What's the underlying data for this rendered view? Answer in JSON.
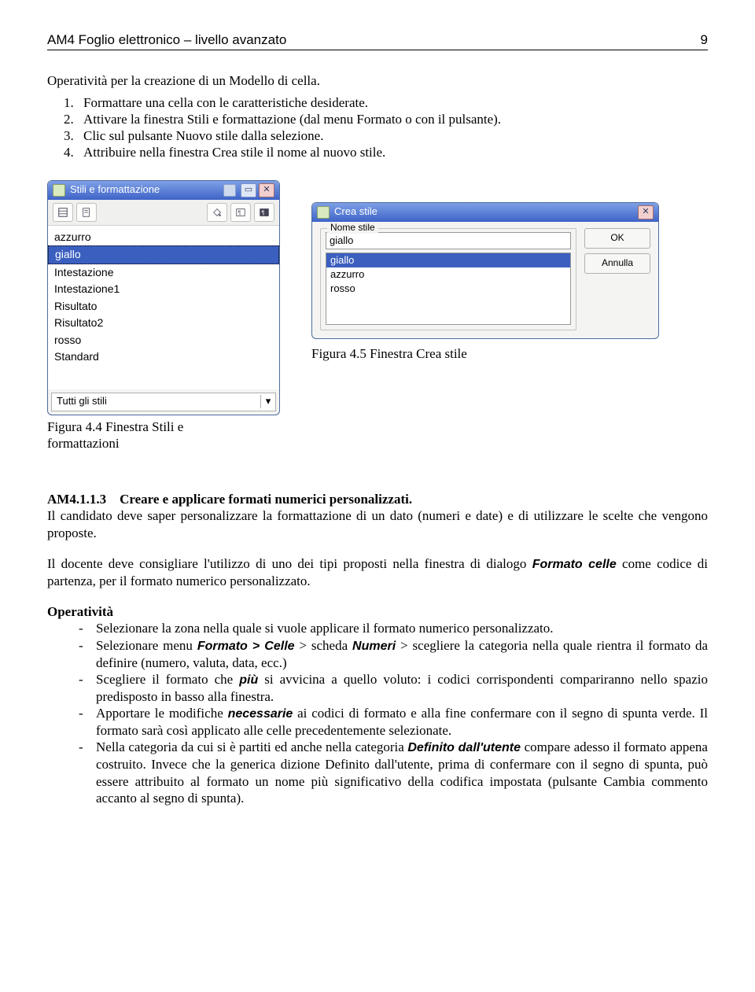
{
  "header": {
    "left": "AM4 Foglio elettronico – livello avanzato",
    "page": "9"
  },
  "section_title": "Operatività per la creazione di un Modello di cella.",
  "steps": [
    "Formattare una cella con le caratteristiche desiderate.",
    "Attivare la finestra Stili e formattazione (dal menu Formato o con il pulsante).",
    "Clic sul pulsante Nuovo stile dalla selezione.",
    "Attribuire nella finestra Crea stile il nome al nuovo stile."
  ],
  "styles_window": {
    "title": "Stili e formattazione",
    "items": [
      "azzurro",
      "giallo",
      "Intestazione",
      "Intestazione1",
      "Risultato",
      "Risultato2",
      "rosso",
      "Standard"
    ],
    "selected_index": 1,
    "combo": "Tutti gli stili"
  },
  "create_dialog": {
    "title": "Crea stile",
    "legend": "Nome stile",
    "input_value": "giallo",
    "list": [
      "giallo",
      "azzurro",
      "rosso"
    ],
    "selected_index": 0,
    "ok": "OK",
    "cancel": "Annulla"
  },
  "caption_right": "Figura 4.5 Finestra Crea stile",
  "caption_left_1": "Figura 4.4 Finestra Stili e",
  "caption_left_2": "formattazioni",
  "sub": {
    "num": "AM4.1.1.3",
    "title": "Creare e applicare formati numerici personalizzati.",
    "para1": "Il candidato deve saper personalizzare la formattazione di un dato (numeri e date) e di utilizzare le scelte che vengono proposte.",
    "para2a": "Il docente deve consigliare l'utilizzo di uno dei tipi proposti nella finestra di dialogo ",
    "para2b_boldit": "Formato celle",
    "para2c": " come codice di partenza, per il formato numerico personalizzato."
  },
  "op_title": "Operatività",
  "ops": {
    "i1": "Selezionare la zona nella quale si vuole applicare il formato numerico personalizzato.",
    "i2a": "Selezionare menu ",
    "i2b": "Formato > Celle",
    "i2c": " > scheda ",
    "i2d": "Numeri",
    "i2e": " > scegliere la categoria nella quale rientra il formato da definire (numero, valuta, data, ecc.)",
    "i3a": "Scegliere il formato che ",
    "i3b": "più",
    "i3c": " si avvicina a quello voluto: i codici corrispondenti compariranno nello spazio predisposto in basso alla finestra.",
    "i4a": "Apportare le modifiche ",
    "i4b": "necessarie",
    "i4c": " ai codici di formato e alla fine confermare con il segno di spunta verde. Il formato sarà così applicato alle celle precedentemente selezionate.",
    "i5a": "Nella categoria da cui si è partiti ed anche nella categoria ",
    "i5b": "Definito dall'utente",
    "i5c": " compare adesso il formato appena costruito. Invece che la generica dizione Definito dall'utente, prima di confermare con il segno di spunta, può essere attribuito al formato un nome più significativo della codifica impostata (pulsante Cambia commento accanto al segno di spunta)."
  }
}
